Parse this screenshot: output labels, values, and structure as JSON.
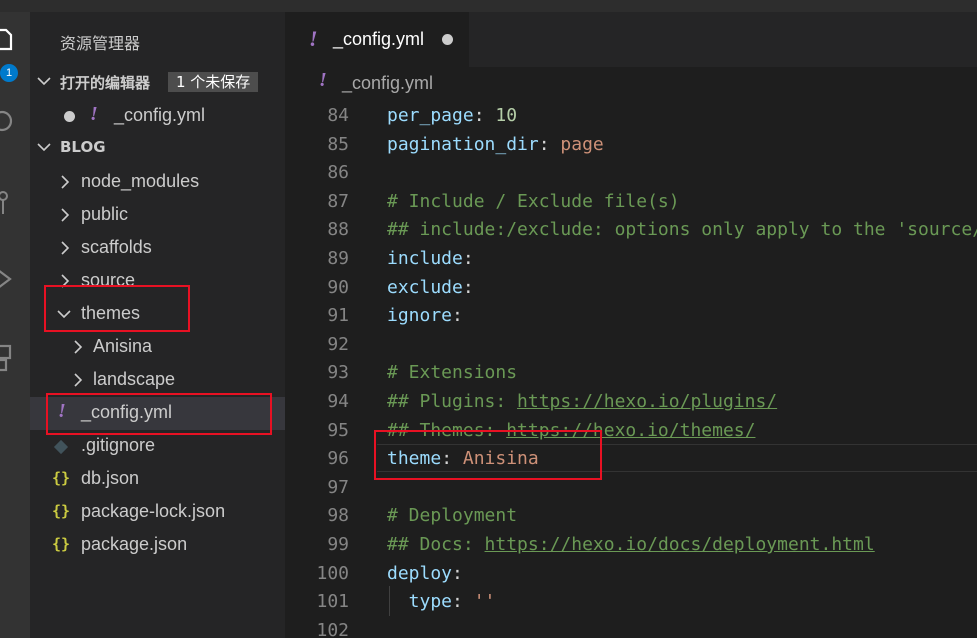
{
  "activity": {
    "badge": "1"
  },
  "sidebar": {
    "title": "资源管理器",
    "open_editors": {
      "label": "打开的编辑器",
      "unsaved": "1 个未保存",
      "file": "_config.yml"
    },
    "project": {
      "label": "BLOG"
    },
    "tree": [
      {
        "label": "node_modules"
      },
      {
        "label": "public"
      },
      {
        "label": "scaffolds"
      },
      {
        "label": "source"
      },
      {
        "label": "themes"
      },
      {
        "label": "Anisina"
      },
      {
        "label": "landscape"
      },
      {
        "label": "_config.yml"
      },
      {
        "label": ".gitignore"
      },
      {
        "label": "db.json"
      },
      {
        "label": "package-lock.json"
      },
      {
        "label": "package.json"
      }
    ]
  },
  "editor": {
    "tab_label": "_config.yml",
    "breadcrumb": "_config.yml",
    "lines": [
      {
        "num": "84",
        "key": "per_page",
        "sep": ": ",
        "val": "10"
      },
      {
        "num": "85",
        "key": "pagination_dir",
        "sep": ": ",
        "val": "page"
      },
      {
        "num": "86"
      },
      {
        "num": "87",
        "comment": "# Include / Exclude file(s)"
      },
      {
        "num": "88",
        "comment": "## include:/exclude: options only apply to the 'source/' folder"
      },
      {
        "num": "89",
        "key": "include",
        "sep": ":"
      },
      {
        "num": "90",
        "key": "exclude",
        "sep": ":"
      },
      {
        "num": "91",
        "key": "ignore",
        "sep": ":"
      },
      {
        "num": "92"
      },
      {
        "num": "93",
        "comment": "# Extensions"
      },
      {
        "num": "94",
        "comment": "## Plugins: ",
        "url": "https://hexo.io/plugins/"
      },
      {
        "num": "95",
        "comment": "## Themes: ",
        "url": "https://hexo.io/themes/"
      },
      {
        "num": "96",
        "key": "theme",
        "sep": ": ",
        "val": "Anisina"
      },
      {
        "num": "97"
      },
      {
        "num": "98",
        "comment": "# Deployment"
      },
      {
        "num": "99",
        "comment": "## Docs: ",
        "url": "https://hexo.io/docs/deployment.html"
      },
      {
        "num": "100",
        "key": "deploy",
        "sep": ":"
      },
      {
        "num": "101",
        "key": "  type",
        "sep": ": ",
        "val": "''"
      },
      {
        "num": "102"
      }
    ]
  },
  "colors": {
    "highlight": "#e81123",
    "accent": "#007acc"
  }
}
